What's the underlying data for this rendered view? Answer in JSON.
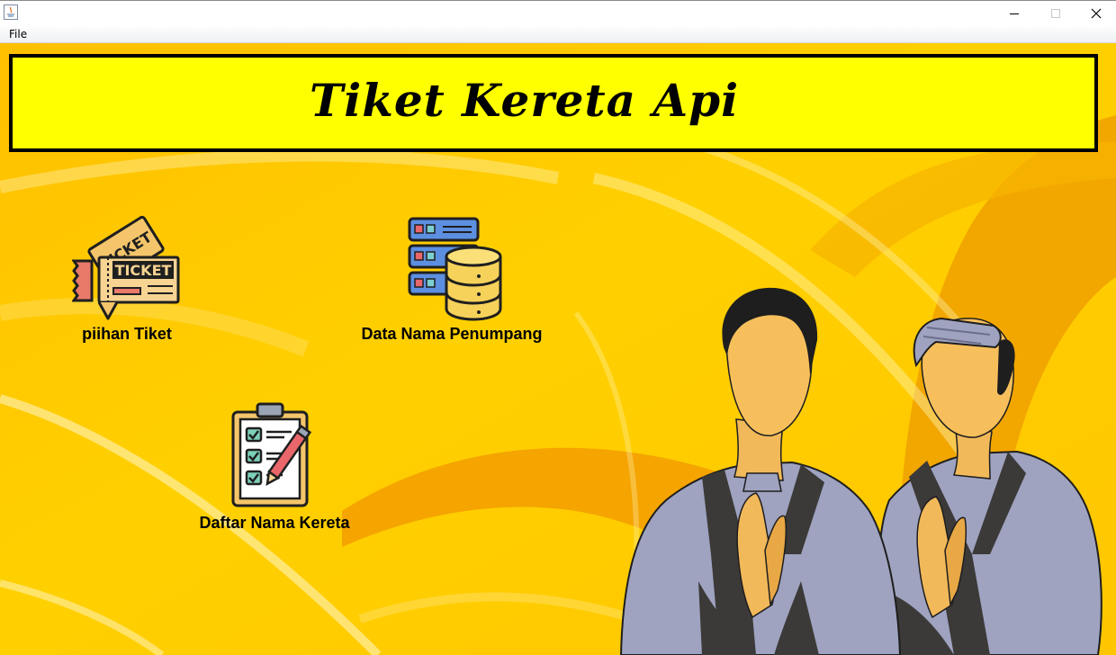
{
  "window": {
    "icon": "java-icon",
    "controls": [
      "minimize-icon",
      "maximize-icon",
      "close-icon"
    ]
  },
  "menubar": {
    "items": [
      {
        "label": "File"
      }
    ]
  },
  "header": {
    "title": "Tiket Kereta Api"
  },
  "tiles": [
    {
      "label": "piihan Tiket",
      "icon": "ticket-icon"
    },
    {
      "label": "Data Nama Penumpang",
      "icon": "database-server-icon"
    },
    {
      "label": "Daftar Nama Kereta",
      "icon": "checklist-clipboard-icon"
    }
  ],
  "illustration": "two-people-greeting-illustration",
  "colors": {
    "banner": "#ffff00",
    "background": "#ffc400",
    "accent_orange": "#f0a000"
  }
}
